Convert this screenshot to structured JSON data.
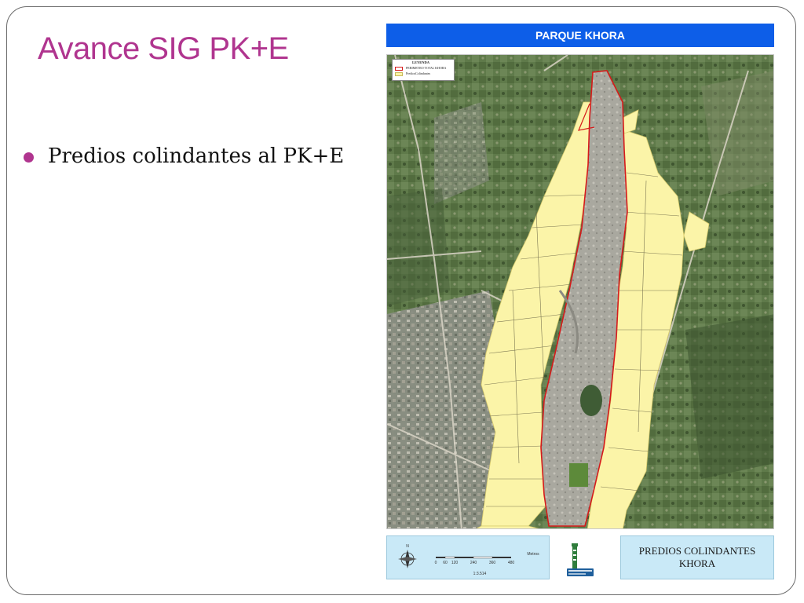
{
  "slide": {
    "title": "Avance SIG PK+E",
    "bullets": [
      "Predios colindantes al PK+E"
    ],
    "accent_color": "#b0358f"
  },
  "map": {
    "header": "PARQUE KHORA",
    "header_color": "#0d5ee8",
    "legend": {
      "title": "LEYENDA",
      "items": [
        {
          "label": "PERIMETRO TOTAL KHORA",
          "color": "#d61a1a"
        },
        {
          "label": "PrediosColindantes",
          "color": "#fbf4a8"
        }
      ]
    },
    "scale": {
      "ticks": [
        "0",
        "60",
        "120",
        "240",
        "360",
        "480"
      ],
      "unit": "Metros",
      "ratio": "1:3.514",
      "compass_label": "N"
    },
    "footer_title_line1": "PREDIOS COLINDANTES",
    "footer_title_line2": "KHORA"
  }
}
